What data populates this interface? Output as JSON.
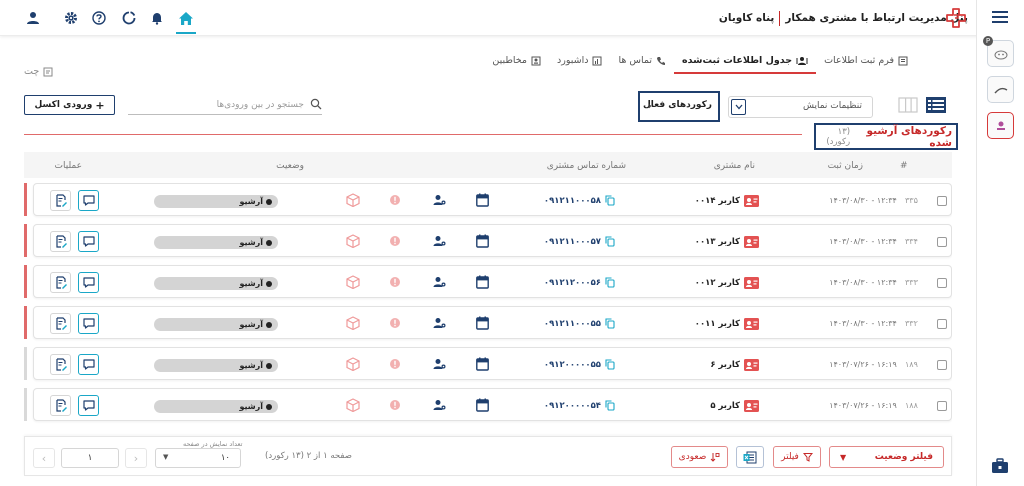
{
  "header": {
    "title": "پنل مدیریت ارتباط با مشتری همکار",
    "company": "پناه کاویان"
  },
  "tabs": [
    {
      "label": "فرم ثبت اطلاعات",
      "icon": "form-icon"
    },
    {
      "label": "جدول اطلاعات ثبت‌شده",
      "icon": "users-table-icon"
    },
    {
      "label": "تماس ها",
      "icon": "phone-icon"
    },
    {
      "label": "داشبورد",
      "icon": "dashboard-icon"
    },
    {
      "label": "مخاطبین",
      "icon": "contacts-icon"
    }
  ],
  "chat_label": "چت",
  "toolbar": {
    "display_settings": "تنظیمات نمایش",
    "active_records": "رکوردهای فعال",
    "search_placeholder": "جستجو در بین ورودی‌ها",
    "excel_label": "ورودی اکسل"
  },
  "archive": {
    "title": "رکوردهای آرشیو شده",
    "count": "(۱۳ رکورد)"
  },
  "table": {
    "columns": {
      "hash": "#",
      "time": "زمان ثبت",
      "name": "نام مشتری",
      "phone": "شماره تماس مشتری",
      "status": "وضعیت",
      "operations": "عملیات"
    },
    "rows": [
      {
        "num": "۳۳۵",
        "time": "۱۴۰۳/۰۸/۳۰ - ۱۲:۳۴",
        "name": "کاربر ۰۰۱۴",
        "phone": "۰۹۱۲۱۱۰۰۰۵۸",
        "status": "آرشیو",
        "bar": "#e06a6a"
      },
      {
        "num": "۳۳۴",
        "time": "۱۴۰۳/۰۸/۳۰ - ۱۲:۳۴",
        "name": "کاربر ۰۰۱۳",
        "phone": "۰۹۱۲۱۱۰۰۰۵۷",
        "status": "آرشیو",
        "bar": "#e06a6a"
      },
      {
        "num": "۳۳۳",
        "time": "۱۴۰۳/۰۸/۳۰ - ۱۲:۳۴",
        "name": "کاربر ۰۰۱۲",
        "phone": "۰۹۱۲۱۲۰۰۰۵۶",
        "status": "آرشیو",
        "bar": "#e06a6a"
      },
      {
        "num": "۳۳۲",
        "time": "۱۴۰۳/۰۸/۳۰ - ۱۲:۳۴",
        "name": "کاربر ۰۰۱۱",
        "phone": "۰۹۱۲۱۱۰۰۰۵۵",
        "status": "آرشیو",
        "bar": "#e06a6a"
      },
      {
        "num": "۱۸۹",
        "time": "۱۴۰۳/۰۷/۲۶ - ۱۶:۱۹",
        "name": "کاربر ۶",
        "phone": "۰۹۱۲۰۰۰۰۰۵۵",
        "status": "آرشیو",
        "bar": "#d9d9d9"
      },
      {
        "num": "۱۸۸",
        "time": "۱۴۰۳/۰۷/۲۶ - ۱۶:۱۹",
        "name": "کاربر ۵",
        "phone": "۰۹۱۲۰۰۰۰۰۵۴",
        "status": "آرشیو",
        "bar": "#d9d9d9"
      }
    ]
  },
  "footer": {
    "status_filter": "فیلتر وضعیت",
    "filter": "فیلتر",
    "sort": "صعودی",
    "page_info": "صفحه ۱ از ۲ (۱۳ رکورد)",
    "per_page_label": "تعداد نمایش در صفحه",
    "per_page": "۱۰",
    "page": "۱"
  },
  "colors": {
    "accent_red": "#c62828",
    "navy": "#1f3f6e",
    "teal": "#1aa7c7"
  }
}
